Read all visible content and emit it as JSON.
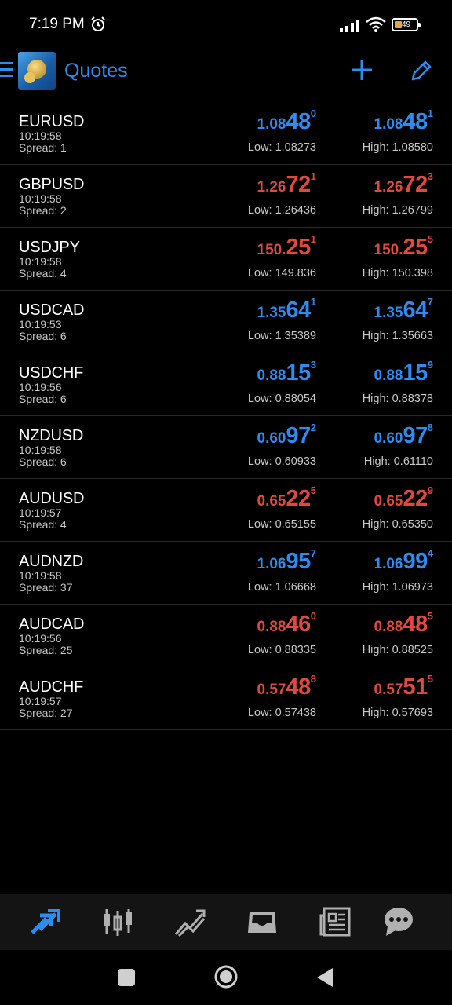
{
  "status": {
    "time": "7:19 PM",
    "battery": "49"
  },
  "app": {
    "title": "Quotes"
  },
  "colors": {
    "up": "#2d8cf0",
    "down": "#e0493e"
  },
  "quotes": [
    {
      "symbol": "EURUSD",
      "time": "10:19:58",
      "spread": "Spread: 1",
      "dir": "blue",
      "bid": {
        "pre": "1.08",
        "big": "48",
        "sup": "0"
      },
      "ask": {
        "pre": "1.08",
        "big": "48",
        "sup": "1"
      },
      "low": "Low: 1.08273",
      "high": "High: 1.08580"
    },
    {
      "symbol": "GBPUSD",
      "time": "10:19:58",
      "spread": "Spread: 2",
      "dir": "red",
      "bid": {
        "pre": "1.26",
        "big": "72",
        "sup": "1"
      },
      "ask": {
        "pre": "1.26",
        "big": "72",
        "sup": "3"
      },
      "low": "Low: 1.26436",
      "high": "High: 1.26799"
    },
    {
      "symbol": "USDJPY",
      "time": "10:19:58",
      "spread": "Spread: 4",
      "dir": "red",
      "bid": {
        "pre": "150.",
        "big": "25",
        "sup": "1"
      },
      "ask": {
        "pre": "150.",
        "big": "25",
        "sup": "5"
      },
      "low": "Low: 149.836",
      "high": "High: 150.398"
    },
    {
      "symbol": "USDCAD",
      "time": "10:19:53",
      "spread": "Spread: 6",
      "dir": "blue",
      "bid": {
        "pre": "1.35",
        "big": "64",
        "sup": "1"
      },
      "ask": {
        "pre": "1.35",
        "big": "64",
        "sup": "7"
      },
      "low": "Low: 1.35389",
      "high": "High: 1.35663"
    },
    {
      "symbol": "USDCHF",
      "time": "10:19:56",
      "spread": "Spread: 6",
      "dir": "blue",
      "bid": {
        "pre": "0.88",
        "big": "15",
        "sup": "3"
      },
      "ask": {
        "pre": "0.88",
        "big": "15",
        "sup": "9"
      },
      "low": "Low: 0.88054",
      "high": "High: 0.88378"
    },
    {
      "symbol": "NZDUSD",
      "time": "10:19:58",
      "spread": "Spread: 6",
      "dir": "blue",
      "bid": {
        "pre": "0.60",
        "big": "97",
        "sup": "2"
      },
      "ask": {
        "pre": "0.60",
        "big": "97",
        "sup": "8"
      },
      "low": "Low: 0.60933",
      "high": "High: 0.61110"
    },
    {
      "symbol": "AUDUSD",
      "time": "10:19:57",
      "spread": "Spread: 4",
      "dir": "red",
      "bid": {
        "pre": "0.65",
        "big": "22",
        "sup": "5"
      },
      "ask": {
        "pre": "0.65",
        "big": "22",
        "sup": "9"
      },
      "low": "Low: 0.65155",
      "high": "High: 0.65350"
    },
    {
      "symbol": "AUDNZD",
      "time": "10:19:58",
      "spread": "Spread: 37",
      "dir": "blue",
      "bid": {
        "pre": "1.06",
        "big": "95",
        "sup": "7"
      },
      "ask": {
        "pre": "1.06",
        "big": "99",
        "sup": "4"
      },
      "low": "Low: 1.06668",
      "high": "High: 1.06973"
    },
    {
      "symbol": "AUDCAD",
      "time": "10:19:56",
      "spread": "Spread: 25",
      "dir": "red",
      "bid": {
        "pre": "0.88",
        "big": "46",
        "sup": "0"
      },
      "ask": {
        "pre": "0.88",
        "big": "48",
        "sup": "5"
      },
      "low": "Low: 0.88335",
      "high": "High: 0.88525"
    },
    {
      "symbol": "AUDCHF",
      "time": "10:19:57",
      "spread": "Spread: 27",
      "dir": "red",
      "bid": {
        "pre": "0.57",
        "big": "48",
        "sup": "8"
      },
      "ask": {
        "pre": "0.57",
        "big": "51",
        "sup": "5"
      },
      "low": "Low: 0.57438",
      "high": "High: 0.57693"
    }
  ],
  "tabs": [
    {
      "icon": "quotes-arrows-icon",
      "active": true
    },
    {
      "icon": "candlestick-chart-icon",
      "active": false
    },
    {
      "icon": "trade-chart-icon",
      "active": false
    },
    {
      "icon": "inbox-icon",
      "active": false
    },
    {
      "icon": "news-icon",
      "active": false
    },
    {
      "icon": "chat-icon",
      "active": false
    }
  ],
  "nav": [
    "recents-button",
    "home-button",
    "back-button"
  ]
}
